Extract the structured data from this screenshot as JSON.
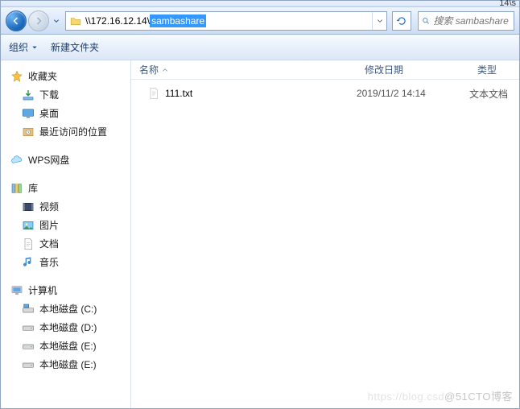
{
  "titlebar": {
    "fragment": "14\\s"
  },
  "address": {
    "plain": "\\\\172.16.12.14\\",
    "highlighted": "sambashare"
  },
  "search": {
    "placeholder": "搜索 sambashare"
  },
  "toolbar": {
    "organize": "组织",
    "new_folder": "新建文件夹"
  },
  "sidebar": {
    "favorites": {
      "label": "收藏夹",
      "items": [
        {
          "label": "下载"
        },
        {
          "label": "桌面"
        },
        {
          "label": "最近访问的位置"
        }
      ]
    },
    "wps": {
      "label": "WPS网盘"
    },
    "libraries": {
      "label": "库",
      "items": [
        {
          "label": "视频"
        },
        {
          "label": "图片"
        },
        {
          "label": "文档"
        },
        {
          "label": "音乐"
        }
      ]
    },
    "computer": {
      "label": "计算机",
      "items": [
        {
          "label": "本地磁盘 (C:)"
        },
        {
          "label": "本地磁盘 (D:)"
        },
        {
          "label": "本地磁盘 (E:)"
        },
        {
          "label": "本地磁盘 (E:)"
        }
      ]
    }
  },
  "columns": {
    "name": "名称",
    "date": "修改日期",
    "type": "类型"
  },
  "files": [
    {
      "name": "111.txt",
      "date": "2019/11/2 14:14",
      "type": "文本文档"
    }
  ],
  "watermark": {
    "faint": "https://blog.csd",
    "bold": "@51CTO博客"
  }
}
